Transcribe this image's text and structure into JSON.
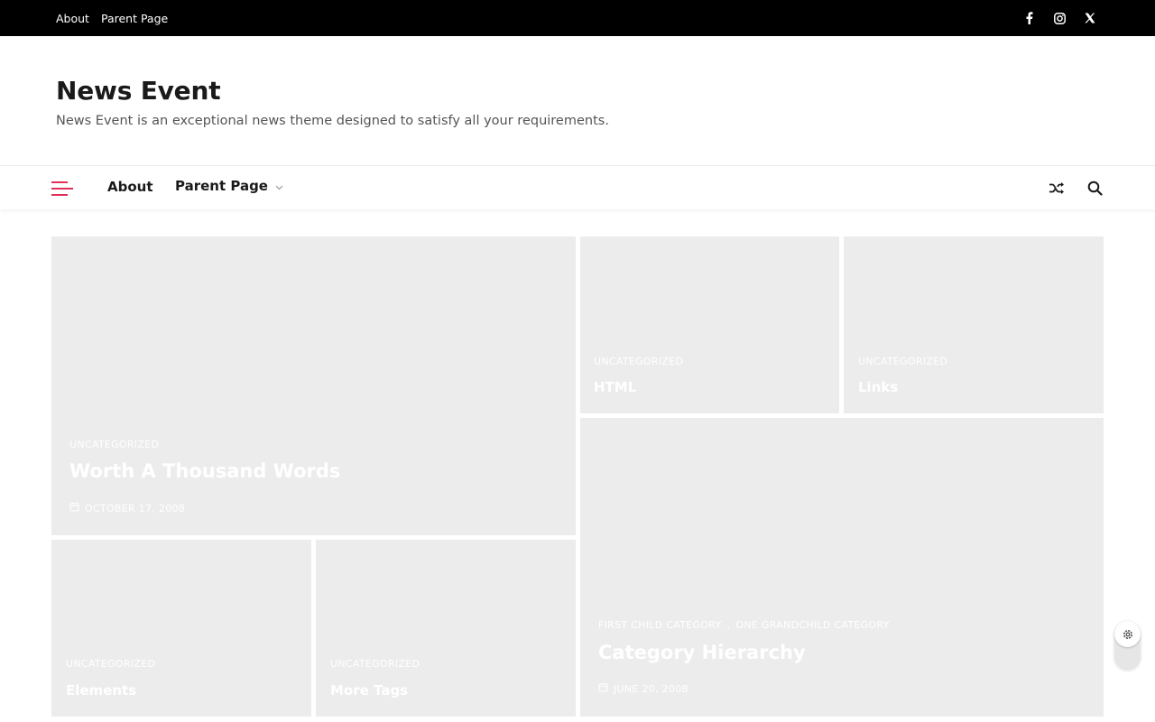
{
  "topbar": {
    "links": [
      "About",
      "Parent Page"
    ],
    "social_icons": [
      "facebook-icon",
      "instagram-icon",
      "x-twitter-icon"
    ]
  },
  "site": {
    "title": "News Event",
    "description": "News Event is an exceptional news theme designed to satisfy all your requirements."
  },
  "nav": {
    "items": [
      "About",
      "Parent Page"
    ],
    "accent_color": "#e0315a"
  },
  "posts": [
    {
      "category": "UNCATEGORIZED",
      "title": "Worth A Thousand Words",
      "date": "OCTOBER 17, 2008"
    },
    {
      "category": "UNCATEGORIZED",
      "title": "HTML"
    },
    {
      "category": "UNCATEGORIZED",
      "title": "Links"
    },
    {
      "categories": [
        "FIRST CHILD CATEGORY",
        "ONE GRANDCHILD CATEGORY"
      ],
      "separator": ",",
      "title": "Category Hierarchy",
      "date": "JUNE 20, 2008"
    },
    {
      "category": "UNCATEGORIZED",
      "title": "Elements"
    },
    {
      "category": "UNCATEGORIZED",
      "title": "More Tags"
    }
  ]
}
